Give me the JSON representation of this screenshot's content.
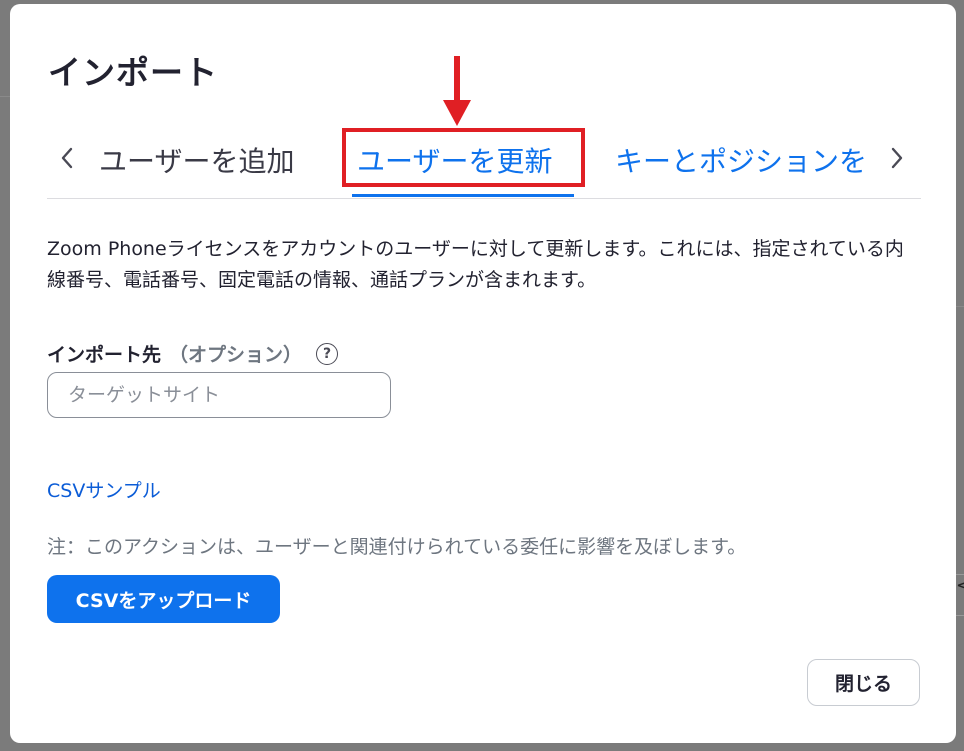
{
  "dialog": {
    "title": "インポート",
    "tabs": [
      {
        "label": "ユーザーを追加",
        "active": false
      },
      {
        "label": "ユーザーを更新",
        "active": true
      },
      {
        "label": "キーとポジションを",
        "active": false
      }
    ],
    "description": "Zoom Phoneライセンスをアカウントのユーザーに対して更新します。これには、指定されている内線番号、電話番号、固定電話の情報、通話プランが含まれます。",
    "import_target": {
      "label": "インポート先",
      "optional": "（オプション）",
      "help_glyph": "?",
      "placeholder": "ターゲットサイト",
      "value": ""
    },
    "csv_sample_link": "CSVサンプル",
    "note": "注：このアクションは、ユーザーと関連付けられている委任に影響を及ぼします。",
    "upload_button": "CSVをアップロード",
    "close_button": "閉じる"
  },
  "icons": {
    "prev": "chevron-left-icon",
    "next": "chevron-right-icon",
    "help": "question-circle-icon"
  },
  "annotation": {
    "box_color": "#e01f24",
    "arrow_color": "#e01f24"
  },
  "colors": {
    "accent": "#0e72ed",
    "link": "#0b5cd7",
    "text": "#222230",
    "muted": "#6e7680"
  }
}
